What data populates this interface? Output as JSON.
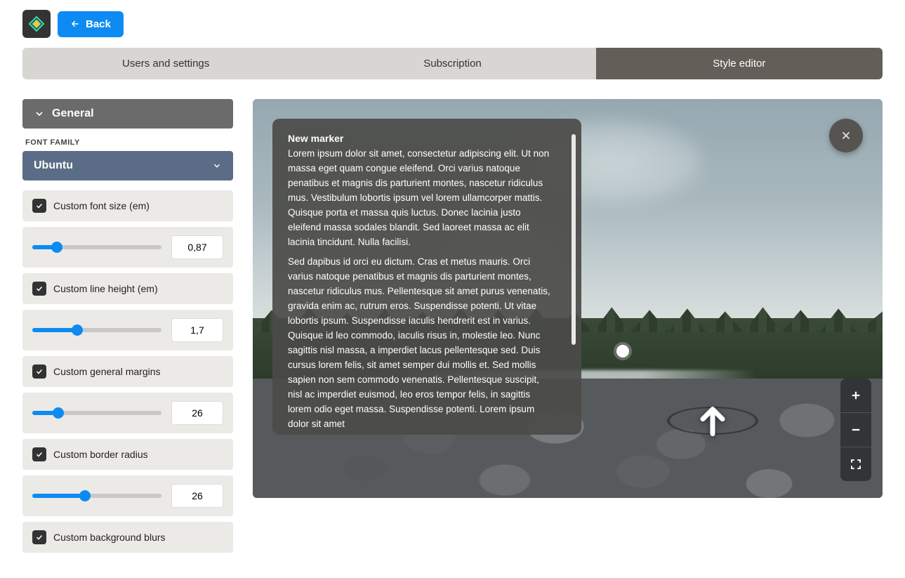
{
  "header": {
    "back_label": "Back"
  },
  "tabs": [
    "Users and settings",
    "Subscription",
    "Style editor"
  ],
  "active_tab": 2,
  "sidebar": {
    "section_title": "General",
    "font_family_label": "FONT FAMILY",
    "font_family_value": "Ubuntu",
    "options": [
      {
        "label": "Custom font size (em)",
        "value": "0,87",
        "fill": 19
      },
      {
        "label": "Custom line height (em)",
        "value": "1,7",
        "fill": 35
      },
      {
        "label": "Custom general margins",
        "value": "26",
        "fill": 20
      },
      {
        "label": "Custom border radius",
        "value": "26",
        "fill": 41
      },
      {
        "label": "Custom background blurs",
        "value": "",
        "fill": 0
      }
    ]
  },
  "preview": {
    "marker_title": "New marker",
    "marker_p1": "Lorem ipsum dolor sit amet, consectetur adipiscing elit. Ut non massa eget quam congue eleifend. Orci varius natoque penatibus et magnis dis parturient montes, nascetur ridiculus mus. Vestibulum lobortis ipsum vel lorem ullamcorper mattis. Quisque porta et massa quis luctus. Donec lacinia justo eleifend massa sodales blandit. Sed laoreet massa ac elit lacinia tincidunt. Nulla facilisi.",
    "marker_p2": "Sed dapibus id orci eu dictum. Cras et metus mauris. Orci varius natoque penatibus et magnis dis parturient montes, nascetur ridiculus mus. Pellentesque sit amet purus venenatis, gravida enim ac, rutrum eros. Suspendisse potenti. Ut vitae lobortis ipsum. Suspendisse iaculis hendrerit est in varius. Quisque id leo commodo, iaculis risus in, molestie leo. Nunc sagittis nisl massa, a imperdiet lacus pellentesque sed. Duis cursus lorem felis, sit amet semper dui mollis et. Sed mollis sapien non sem commodo venenatis. Pellentesque suscipit, nisl ac imperdiet euismod, leo eros tempor felis, in sagittis lorem odio eget massa. Suspendisse potenti. Lorem ipsum dolor sit amet"
  }
}
